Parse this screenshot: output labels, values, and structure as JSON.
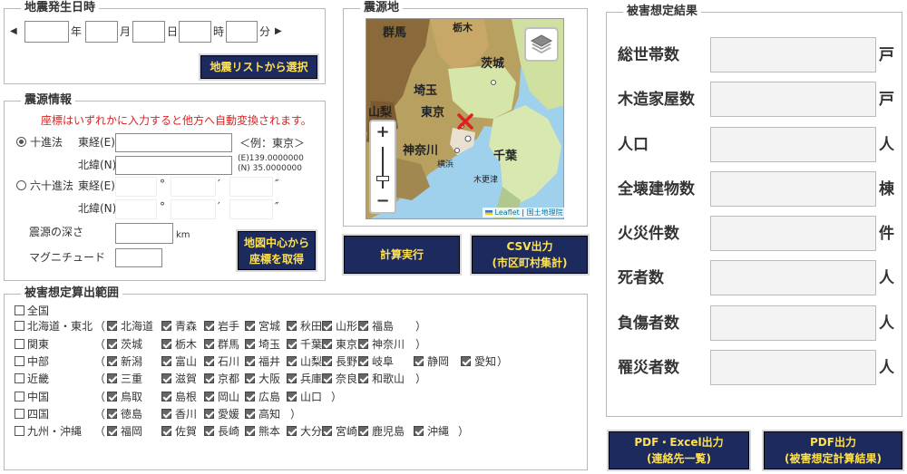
{
  "datetime": {
    "legend": "地震発生日時",
    "year_unit": "年",
    "month_unit": "月",
    "day_unit": "日",
    "hour_unit": "時",
    "minute_unit": "分",
    "prev_arrow": "◀",
    "next_arrow": "▶",
    "select_button": "地震リストから選択"
  },
  "source": {
    "legend": "震源情報",
    "note": "座標はいずれかに入力すると他方へ自動変換されます。",
    "decimal_label": "十進法",
    "east_label": "東経(E)",
    "north_label": "北緯(N)",
    "example": "＜例：東京＞",
    "example_e": "(E)139.0000000",
    "example_n": "(N) 35.0000000",
    "sexagesimal_label": "六十進法",
    "deg_sym": "°",
    "min_sym": "′",
    "sec_sym": "″",
    "depth_label": "震源の深さ",
    "depth_unit": "km",
    "magnitude_label": "マグニチュード",
    "map_center_button": [
      "地図中心から",
      "座標を取得"
    ]
  },
  "map": {
    "legend": "震源地",
    "zoom_in": "+",
    "zoom_out": "−",
    "attribution_leaflet": "Leaflet",
    "attribution_sep": "|",
    "attribution_gsi": "国土地理院",
    "labels": {
      "gunma": "群馬",
      "tochigi": "栃木",
      "ibaraki": "茨城",
      "saitama": "埼玉",
      "yamanashi": "山梨",
      "tokyo": "東京",
      "kanagawa": "神奈川",
      "chiba": "千葉",
      "kofu": "甲府",
      "yokohama": "横浜",
      "kisarazu": "木更津"
    }
  },
  "actions": {
    "calc_button": "計算実行",
    "csv_button": [
      "CSV出力",
      "(市区町村集計)"
    ],
    "pdf_excel_button": [
      "PDF・Excel出力",
      "(連絡先一覧)"
    ],
    "pdf_button": [
      "PDF出力",
      "(被害想定計算結果)"
    ]
  },
  "results": {
    "legend": "被害想定結果",
    "rows": [
      {
        "label": "総世帯数",
        "unit": "戸"
      },
      {
        "label": "木造家屋数",
        "unit": "戸"
      },
      {
        "label": "人口",
        "unit": "人"
      },
      {
        "label": "全壊建物数",
        "unit": "棟"
      },
      {
        "label": "火災件数",
        "unit": "件"
      },
      {
        "label": "死者数",
        "unit": "人"
      },
      {
        "label": "負傷者数",
        "unit": "人"
      },
      {
        "label": "罹災者数",
        "unit": "人"
      }
    ]
  },
  "range": {
    "legend": "被害想定算出範囲",
    "all_label": "全国",
    "paren_open": "（",
    "paren_close": "）",
    "regions": [
      {
        "name": "北海道・東北",
        "prefs": [
          "北海道",
          "青森",
          "岩手",
          "宮城",
          "秋田",
          "山形",
          "福島"
        ]
      },
      {
        "name": "関東",
        "prefs": [
          "茨城",
          "栃木",
          "群馬",
          "埼玉",
          "千葉",
          "東京",
          "神奈川"
        ]
      },
      {
        "name": "中部",
        "prefs": [
          "新潟",
          "富山",
          "石川",
          "福井",
          "山梨",
          "長野",
          "岐阜",
          "静岡",
          "愛知"
        ]
      },
      {
        "name": "近畿",
        "prefs": [
          "三重",
          "滋賀",
          "京都",
          "大阪",
          "兵庫",
          "奈良",
          "和歌山"
        ]
      },
      {
        "name": "中国",
        "prefs": [
          "鳥取",
          "島根",
          "岡山",
          "広島",
          "山口"
        ]
      },
      {
        "name": "四国",
        "prefs": [
          "徳島",
          "香川",
          "愛媛",
          "高知"
        ]
      },
      {
        "name": "九州・沖縄",
        "prefs": [
          "福岡",
          "佐賀",
          "長崎",
          "熊本",
          "大分",
          "宮崎",
          "鹿児島",
          "沖縄"
        ]
      }
    ]
  },
  "colors": {
    "button_bg": "#1c2a5e",
    "button_text": "#ffe14d",
    "note_red": "#e02020",
    "marker_red": "#e02020"
  }
}
